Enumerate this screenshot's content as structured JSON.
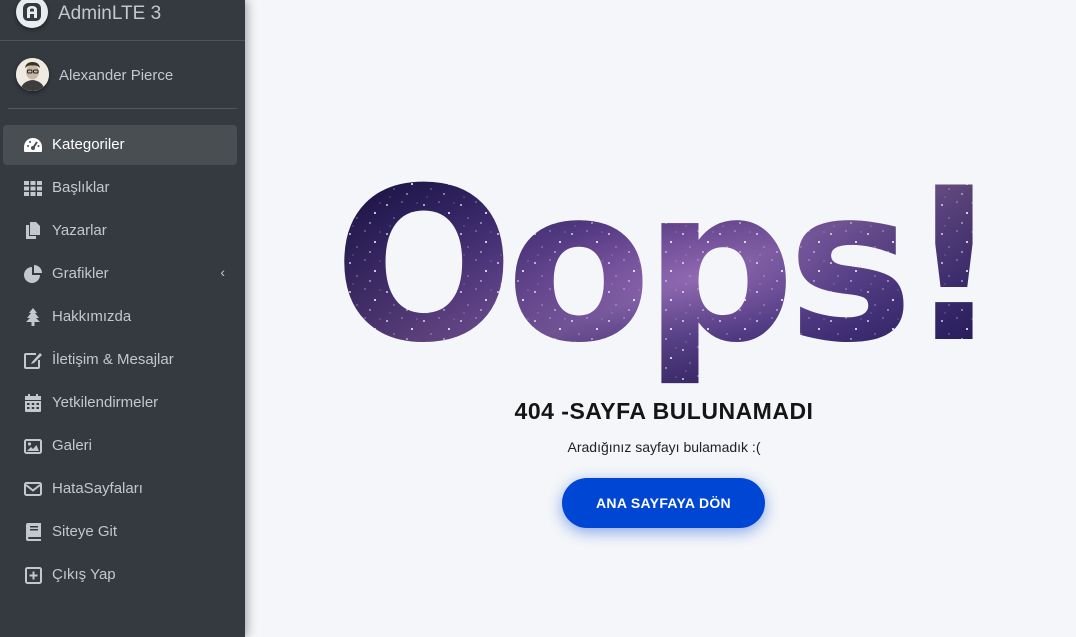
{
  "brand": {
    "name": "AdminLTE 3",
    "logo_icon": "adminlte-logo-icon"
  },
  "user": {
    "name": "Alexander Pierce",
    "avatar_icon": "user-avatar"
  },
  "sidebar": {
    "items": [
      {
        "label": "Kategoriler",
        "icon": "tachometer-icon",
        "active": true
      },
      {
        "label": "Başlıklar",
        "icon": "th-grid-icon"
      },
      {
        "label": "Yazarlar",
        "icon": "copy-icon"
      },
      {
        "label": "Grafikler",
        "icon": "chart-pie-icon",
        "has_submenu": true,
        "arrow": "‹"
      },
      {
        "label": "Hakkımızda",
        "icon": "tree-icon"
      },
      {
        "label": "İletişim & Mesajlar",
        "icon": "edit-icon"
      },
      {
        "label": "Yetkilendirmeler",
        "icon": "calendar-icon"
      },
      {
        "label": "Galeri",
        "icon": "image-icon"
      },
      {
        "label": "HataSayfaları",
        "icon": "envelope-icon"
      },
      {
        "label": "Siteye Git",
        "icon": "book-icon"
      },
      {
        "label": "Çıkış Yap",
        "icon": "plus-square-icon"
      }
    ]
  },
  "main": {
    "headline": "Oops!",
    "error_title": "404 -SAYFA BULUNAMADI",
    "error_description": "Aradığınız sayfayı bulamadık :(",
    "home_button": "ANA SAYFAYA DÖN"
  },
  "colors": {
    "sidebar_bg": "#343a40",
    "active_item_bg": "#494e53",
    "page_bg": "#f4f6f9",
    "button_bg": "#0046d5",
    "galaxy_dark": "#1a1340",
    "galaxy_mid": "#3b2a80"
  }
}
